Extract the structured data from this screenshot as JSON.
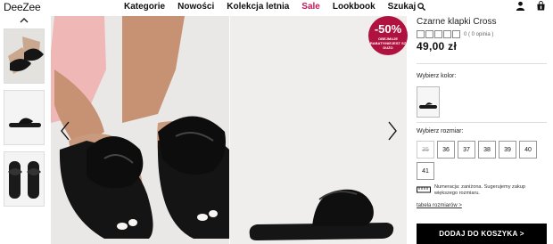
{
  "header": {
    "logo": "DeeZee",
    "nav": [
      "Kategorie",
      "Nowości",
      "Kolekcja letnia",
      "Sale",
      "Lookbook",
      "Szukaj"
    ]
  },
  "badge": {
    "percent": "-50%",
    "subtext": "OBEJMUJE RABATY/NIEJEST SZ DUŻO"
  },
  "product": {
    "title": "Czarne klapki Cross",
    "rating_text": "0 ( 0 opinia )",
    "price": "49,00 zł",
    "color_label": "Wybierz kolor:",
    "size_label": "Wybierz rozmiar:",
    "sizes": [
      "35",
      "36",
      "37",
      "38",
      "39",
      "40",
      "41"
    ],
    "disabled_sizes": [
      "35"
    ],
    "size_info": "Numeracja: zaniżona. Sugerujemy zakup większego rozmiaru.",
    "size_table_link": "tabela rozmiarów >",
    "cart_button": "DODAJ DO KOSZYKA >"
  },
  "colors": {
    "accent": "#c2185b",
    "badge": "#b0123f",
    "button": "#000000"
  }
}
